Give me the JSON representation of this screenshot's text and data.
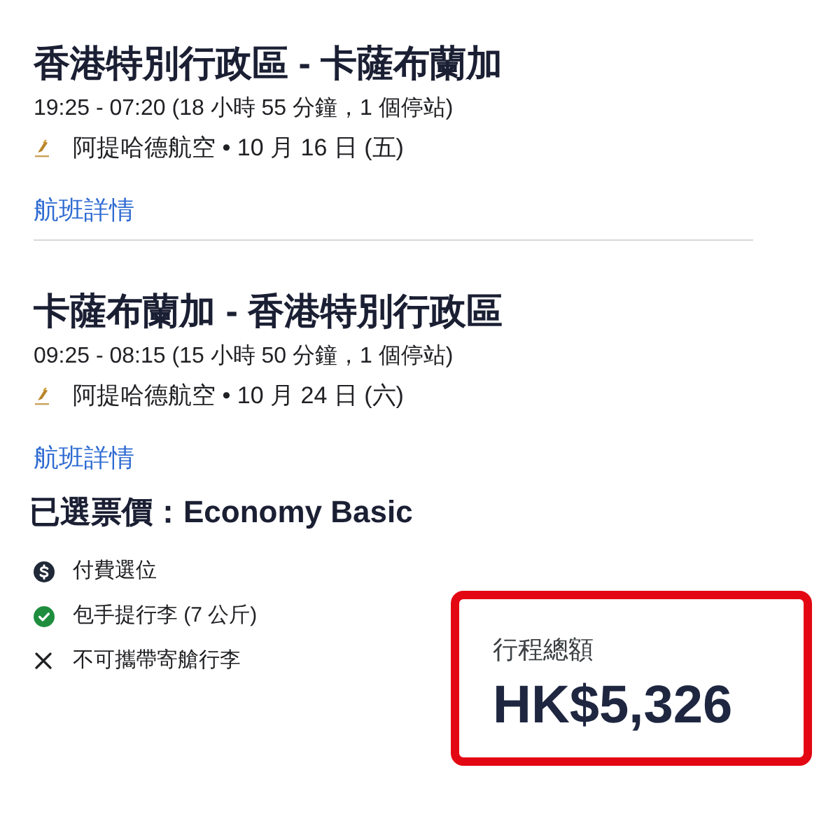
{
  "flights": [
    {
      "route": "香港特別行政區 - 卡薩布蘭加",
      "times": "19:25 - 07:20 (18 小時 55 分鐘，1 個停站)",
      "carrier": "阿提哈德航空 • 10 月 16 日 (五)",
      "details_link": "航班詳情"
    },
    {
      "route": "卡薩布蘭加 - 香港特別行政區",
      "times": "09:25 - 08:15 (15 小時 50 分鐘，1 個停站)",
      "carrier": "阿提哈德航空 • 10 月 24 日 (六)",
      "details_link": "航班詳情"
    }
  ],
  "fare": {
    "heading": "已選票價：Economy Basic"
  },
  "features": [
    {
      "kind": "paid",
      "text": "付費選位"
    },
    {
      "kind": "included",
      "text": "包手提行李 (7 公斤)"
    },
    {
      "kind": "excluded",
      "text": "不可攜帶寄艙行李"
    }
  ],
  "total": {
    "label": "行程總額",
    "amount": "HK$5,326"
  }
}
